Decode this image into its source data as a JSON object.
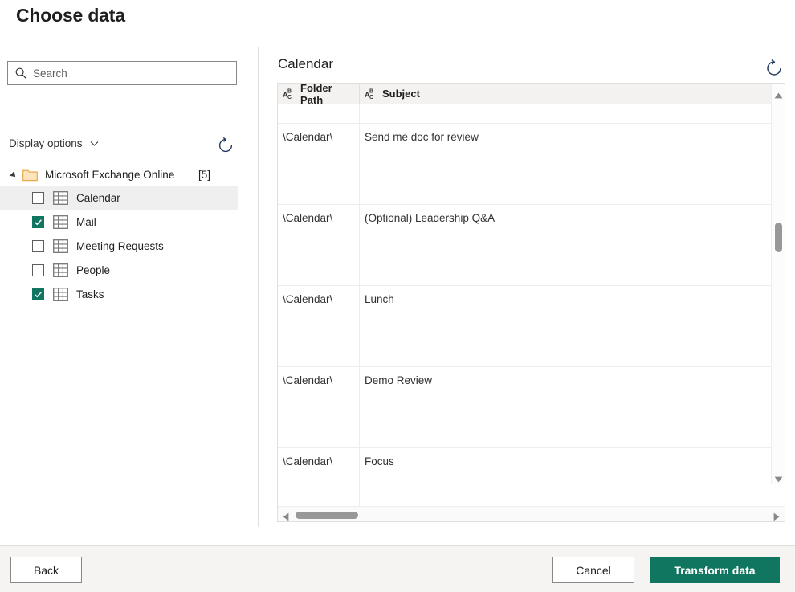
{
  "dialog": {
    "title": "Choose data"
  },
  "search": {
    "placeholder": "Search",
    "value": "",
    "icon": "search-icon"
  },
  "display_options": {
    "label": "Display options",
    "chevron_icon": "chevron-down-icon",
    "refresh_icon": "refresh-icon"
  },
  "tree": {
    "root": {
      "label": "Microsoft Exchange Online",
      "count": "[5]",
      "expander_icon": "triangle-expanded-icon",
      "folder_icon": "folder-icon"
    },
    "items": [
      {
        "label": "Calendar",
        "checked": false,
        "selected": true,
        "icon": "table-icon"
      },
      {
        "label": "Mail",
        "checked": true,
        "selected": false,
        "icon": "table-icon"
      },
      {
        "label": "Meeting Requests",
        "checked": false,
        "selected": false,
        "icon": "table-icon"
      },
      {
        "label": "People",
        "checked": false,
        "selected": false,
        "icon": "table-icon"
      },
      {
        "label": "Tasks",
        "checked": true,
        "selected": false,
        "icon": "table-icon"
      }
    ]
  },
  "preview": {
    "title": "Calendar",
    "refresh_icon": "refresh-icon",
    "columns": [
      {
        "name": "Folder Path",
        "type_icon": "abc-text-type-icon"
      },
      {
        "name": "Subject",
        "type_icon": "abc-text-type-icon"
      }
    ],
    "rows": [
      {
        "folder_path": "",
        "subject": ""
      },
      {
        "folder_path": "\\Calendar\\",
        "subject": "Send me doc for review"
      },
      {
        "folder_path": "\\Calendar\\",
        "subject": "(Optional) Leadership Q&A"
      },
      {
        "folder_path": "\\Calendar\\",
        "subject": "Lunch"
      },
      {
        "folder_path": "\\Calendar\\",
        "subject": "Demo Review"
      },
      {
        "folder_path": "\\Calendar\\",
        "subject": "Focus"
      }
    ],
    "scroll": {
      "up_icon": "scroll-up-arrow-icon",
      "down_icon": "scroll-down-arrow-icon",
      "left_icon": "scroll-left-arrow-icon",
      "right_icon": "scroll-right-arrow-icon"
    }
  },
  "footer": {
    "back_label": "Back",
    "cancel_label": "Cancel",
    "primary_label": "Transform data"
  },
  "colors": {
    "accent_green": "#11765f",
    "folder_orange": "#e8a33d",
    "icon_navy": "#243a5e",
    "border": "#e1dfdd",
    "footer_bg": "#f5f4f2",
    "selected_row": "#efefef"
  }
}
